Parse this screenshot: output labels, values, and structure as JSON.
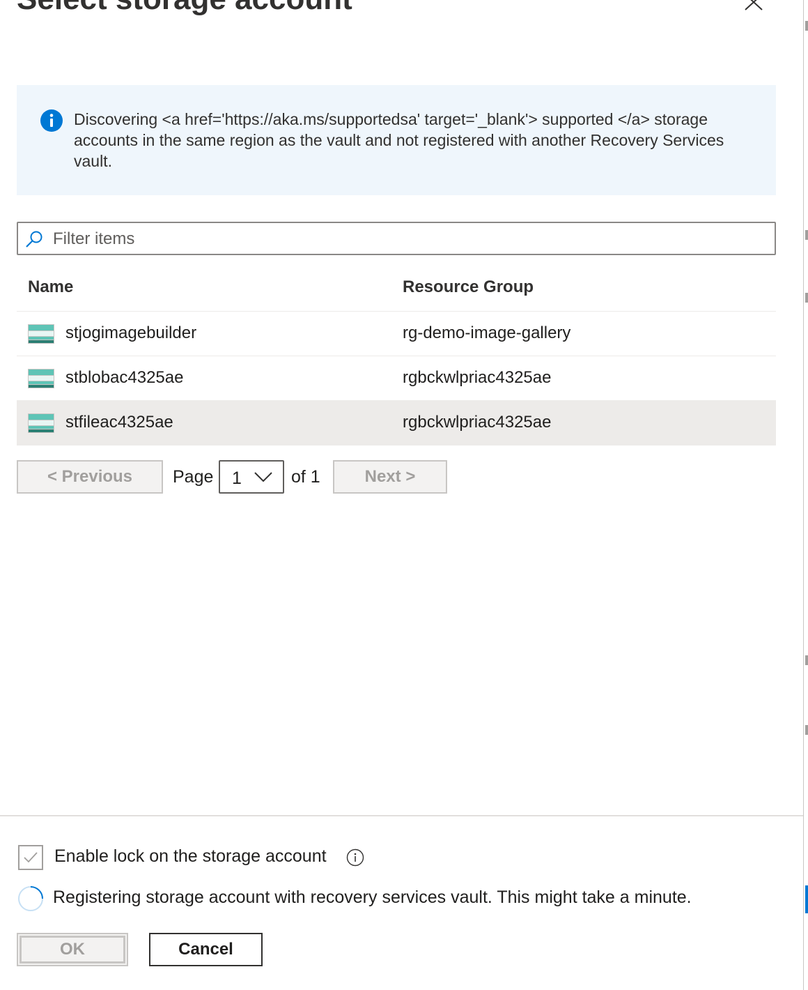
{
  "dialog": {
    "title": "Select storage account",
    "close_icon": "close-icon"
  },
  "info_bar": {
    "icon": "info-icon",
    "text": "Discovering <a href='https://aka.ms/supportedsa' target='_blank'> supported </a> storage accounts in the same region as the vault and not registered with another Recovery Services vault."
  },
  "filter": {
    "placeholder": "Filter items",
    "value": "",
    "icon": "search-icon"
  },
  "grid": {
    "columns": [
      "Name",
      "Resource Group"
    ],
    "rows": [
      {
        "name": "stjogimagebuilder",
        "resource_group": "rg-demo-image-gallery",
        "selected": false
      },
      {
        "name": "stblobac4325ae",
        "resource_group": "rgbckwlpriac4325ae",
        "selected": false
      },
      {
        "name": "stfileac4325ae",
        "resource_group": "rgbckwlpriac4325ae",
        "selected": true
      }
    ],
    "row_icon": "storage-account-icon"
  },
  "pager": {
    "previous_label": "< Previous",
    "page_label": "Page",
    "current_page": "1",
    "of_label": "of 1",
    "next_label": "Next >"
  },
  "footer": {
    "lock_label": "Enable lock on the storage account",
    "lock_checked": true,
    "status_text": "Registering storage account with recovery services vault. This might take a minute.",
    "ok_label": "OK",
    "cancel_label": "Cancel"
  },
  "colors": {
    "info_background": "#eff6fc",
    "info_icon": "#0078d4",
    "selected_row": "#edebe9",
    "storage_icon_teal": "#5ec4b6"
  }
}
